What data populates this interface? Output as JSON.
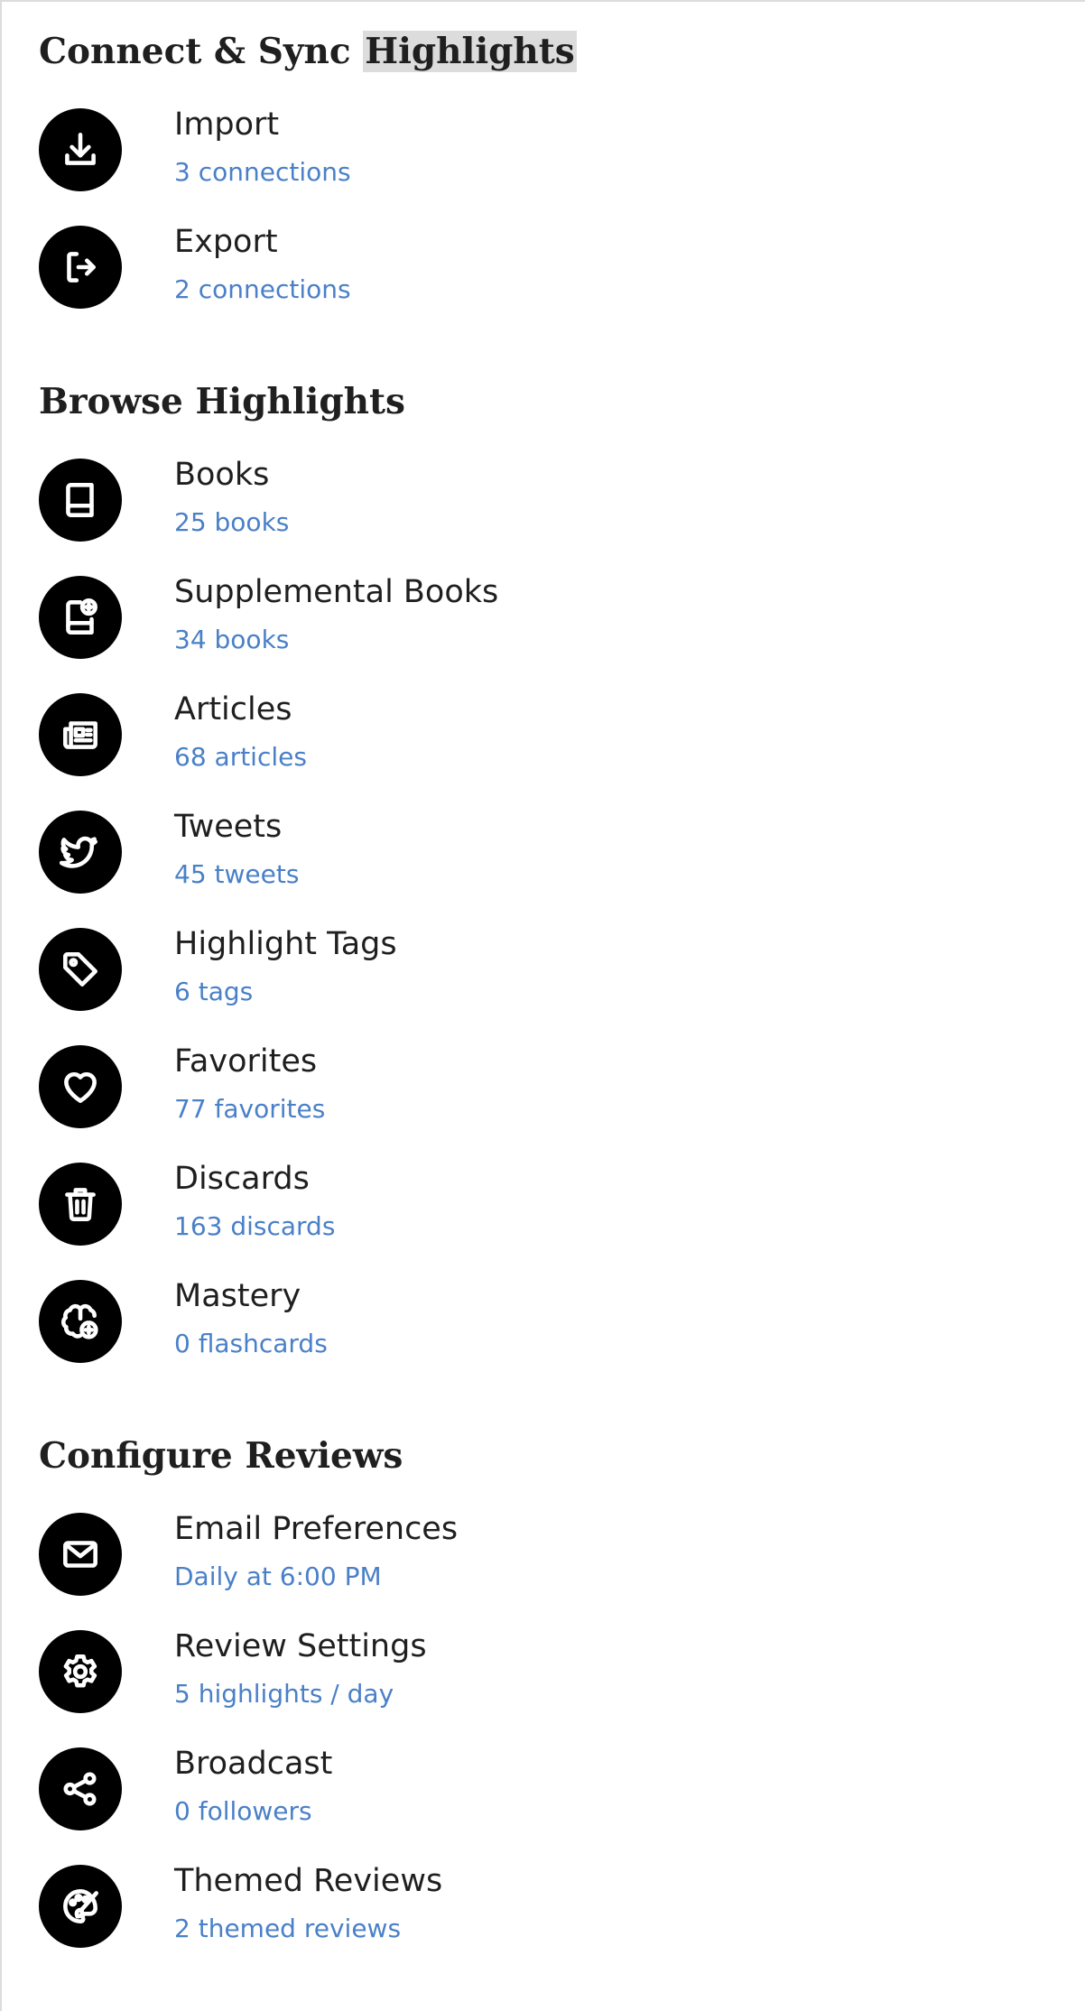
{
  "sections": [
    {
      "title_prefix": "Connect & Sync",
      "title_highlight": "Highlights",
      "items": [
        {
          "label": "Import",
          "sub": "3 connections",
          "icon": "import-icon"
        },
        {
          "label": "Export",
          "sub": "2 connections",
          "icon": "export-icon"
        }
      ]
    },
    {
      "title": "Browse Highlights",
      "items": [
        {
          "label": "Books",
          "sub": "25 books",
          "icon": "book-icon"
        },
        {
          "label": "Supplemental Books",
          "sub": "34 books",
          "icon": "book-plus-icon"
        },
        {
          "label": "Articles",
          "sub": "68 articles",
          "icon": "newspaper-icon"
        },
        {
          "label": "Tweets",
          "sub": "45 tweets",
          "icon": "twitter-icon"
        },
        {
          "label": "Highlight Tags",
          "sub": "6 tags",
          "icon": "tag-icon"
        },
        {
          "label": "Favorites",
          "sub": "77 favorites",
          "icon": "heart-icon"
        },
        {
          "label": "Discards",
          "sub": "163 discards",
          "icon": "trash-icon"
        },
        {
          "label": "Mastery",
          "sub": "0 flashcards",
          "icon": "brain-plus-icon"
        }
      ]
    },
    {
      "title": "Configure Reviews",
      "items": [
        {
          "label": "Email Preferences",
          "sub": "Daily at 6:00 PM",
          "icon": "mail-icon"
        },
        {
          "label": "Review Settings",
          "sub": "5 highlights / day",
          "icon": "gear-icon"
        },
        {
          "label": "Broadcast",
          "sub": "0 followers",
          "icon": "share-icon"
        },
        {
          "label": "Themed Reviews",
          "sub": "2 themed reviews",
          "icon": "palette-icon"
        }
      ]
    }
  ],
  "colors": {
    "accent": "#4a80c8",
    "icon_bg": "#000000",
    "text": "#1f1f1f",
    "title_highlight": "#dcdcdc"
  }
}
